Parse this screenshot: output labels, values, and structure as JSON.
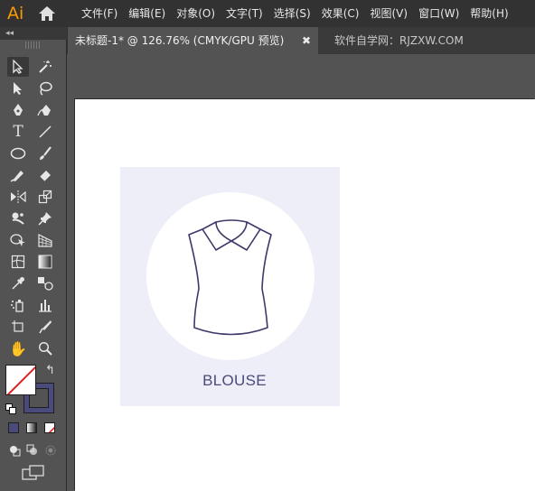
{
  "app": {
    "logo": "Ai"
  },
  "menu": {
    "items": [
      "文件(F)",
      "编辑(E)",
      "对象(O)",
      "文字(T)",
      "选择(S)",
      "效果(C)",
      "视图(V)",
      "窗口(W)",
      "帮助(H)"
    ]
  },
  "tabs": {
    "panel_collapse": "◂◂",
    "active": {
      "label": "未标题-1* @ 126.76% (CMYK/GPU 预览)",
      "close": "✖"
    },
    "inactive": {
      "label": "软件自学网：RJZXW.COM"
    }
  },
  "tools": {
    "type_tool_glyph": "T",
    "hand_tool_glyph": "✋",
    "swap_glyph": "↰"
  },
  "colors": {
    "fill": "#ffffff",
    "stroke": "#4a4b7c",
    "card_bg": "#eeeef8",
    "label_color": "#4b4a7a",
    "icon_stroke": "#3d3a6b"
  },
  "artwork": {
    "label": "BLOUSE"
  }
}
